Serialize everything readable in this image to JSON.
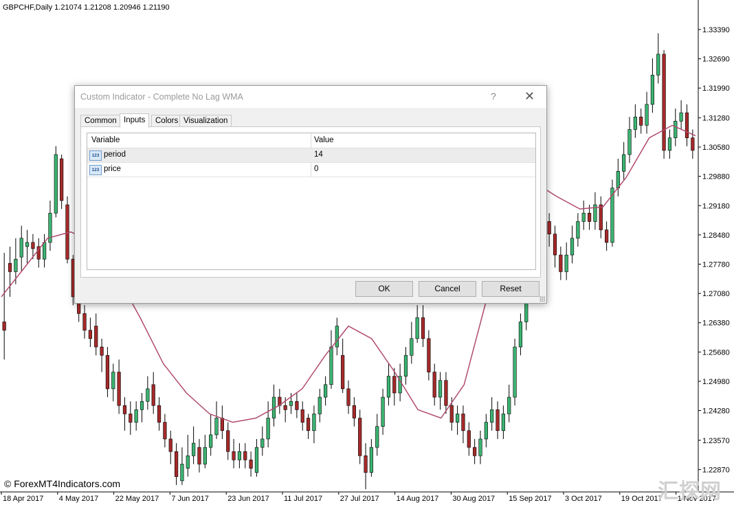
{
  "chart_header": "GBPCHF,Daily  1.21074 1.21208 1.20946 1.21190",
  "price_axis": [
    "1.33390",
    "1.32690",
    "1.31990",
    "1.31280",
    "1.30580",
    "1.29880",
    "1.29180",
    "1.28480",
    "1.27780",
    "1.27080",
    "1.26380",
    "1.25680",
    "1.24980",
    "1.24280",
    "1.23570",
    "1.22870"
  ],
  "date_axis": [
    "18 Apr 2017",
    "4 May 2017",
    "22 May 2017",
    "7 Jun 2017",
    "23 Jun 2017",
    "11 Jul 2017",
    "27 Jul 2017",
    "14 Aug 2017",
    "30 Aug 2017",
    "15 Sep 2017",
    "3 Oct 2017",
    "19 Oct 2017",
    "1 Nov 2017"
  ],
  "watermark": "© ForexMT4Indicators.com",
  "corner_watermark": "汇探网",
  "colors": {
    "bull": "#3cb371",
    "bear": "#a52a2a",
    "wma": "#b04a6e",
    "axis": "#000000"
  },
  "chart_data": {
    "type": "candlestick",
    "symbol": "GBPCHF",
    "timeframe": "Daily",
    "header_ohlc": {
      "open": 1.21074,
      "high": 1.21208,
      "low": 1.20946,
      "close": 1.2119
    },
    "ylim": [
      1.224,
      1.338
    ],
    "indicator": "Complete No Lag WMA (period 14)",
    "wma": [
      1.27,
      1.277,
      1.284,
      1.2855,
      1.283,
      1.275,
      1.265,
      1.254,
      1.247,
      1.242,
      1.24,
      1.241,
      1.244,
      1.248,
      1.256,
      1.263,
      1.26,
      1.252,
      1.243,
      1.241,
      1.249,
      1.27,
      1.292,
      1.2975,
      1.294,
      1.291,
      1.2915,
      1.2985,
      1.308,
      1.311,
      1.3085
    ],
    "candles": [
      [
        1.264,
        1.262,
        1.2805,
        1.255
      ],
      [
        1.278,
        1.276,
        1.282,
        1.27
      ],
      [
        1.276,
        1.279,
        1.284,
        1.273
      ],
      [
        1.2795,
        1.284,
        1.287,
        1.276
      ],
      [
        1.282,
        1.283,
        1.286,
        1.278
      ],
      [
        1.283,
        1.2815,
        1.285,
        1.279
      ],
      [
        1.282,
        1.279,
        1.284,
        1.277
      ],
      [
        1.279,
        1.283,
        1.285,
        1.277
      ],
      [
        1.283,
        1.29,
        1.293,
        1.281
      ],
      [
        1.29,
        1.304,
        1.306,
        1.289
      ],
      [
        1.303,
        1.293,
        1.304,
        1.291
      ],
      [
        1.292,
        1.279,
        1.294,
        1.278
      ],
      [
        1.279,
        1.27,
        1.28,
        1.268
      ],
      [
        1.27,
        1.266,
        1.272,
        1.264
      ],
      [
        1.266,
        1.262,
        1.268,
        1.26
      ],
      [
        1.262,
        1.26,
        1.265,
        1.258
      ],
      [
        1.263,
        1.258,
        1.266,
        1.256
      ],
      [
        1.258,
        1.256,
        1.26,
        1.252
      ],
      [
        1.256,
        1.248,
        1.258,
        1.246
      ],
      [
        1.248,
        1.252,
        1.254,
        1.245
      ],
      [
        1.252,
        1.244,
        1.255,
        1.242
      ],
      [
        1.244,
        1.242,
        1.246,
        1.238
      ],
      [
        1.242,
        1.24,
        1.245,
        1.237
      ],
      [
        1.24,
        1.243,
        1.245,
        1.238
      ],
      [
        1.243,
        1.245,
        1.247,
        1.24
      ],
      [
        1.245,
        1.248,
        1.251,
        1.243
      ],
      [
        1.249,
        1.244,
        1.252,
        1.242
      ],
      [
        1.244,
        1.24,
        1.246,
        1.238
      ],
      [
        1.24,
        1.236,
        1.242,
        1.234
      ],
      [
        1.236,
        1.233,
        1.238,
        1.23
      ],
      [
        1.233,
        1.227,
        1.235,
        1.225
      ],
      [
        1.226,
        1.23,
        1.234,
        1.225
      ],
      [
        1.229,
        1.232,
        1.237,
        1.227
      ],
      [
        1.232,
        1.235,
        1.239,
        1.23
      ],
      [
        1.234,
        1.23,
        1.236,
        1.228
      ],
      [
        1.23,
        1.234,
        1.237,
        1.229
      ],
      [
        1.234,
        1.237,
        1.242,
        1.232
      ],
      [
        1.237,
        1.241,
        1.245,
        1.236
      ],
      [
        1.241,
        1.238,
        1.244,
        1.236
      ],
      [
        1.238,
        1.233,
        1.24,
        1.231
      ],
      [
        1.233,
        1.231,
        1.236,
        1.229
      ],
      [
        1.231,
        1.233,
        1.235,
        1.229
      ],
      [
        1.233,
        1.231,
        1.235,
        1.229
      ],
      [
        1.231,
        1.229,
        1.233,
        1.227
      ],
      [
        1.228,
        1.234,
        1.236,
        1.227
      ],
      [
        1.234,
        1.236,
        1.239,
        1.232
      ],
      [
        1.236,
        1.241,
        1.245,
        1.234
      ],
      [
        1.241,
        1.246,
        1.249,
        1.239
      ],
      [
        1.246,
        1.244,
        1.248,
        1.242
      ],
      [
        1.244,
        1.243,
        1.246,
        1.24
      ],
      [
        1.244,
        1.245,
        1.247,
        1.242
      ],
      [
        1.245,
        1.243,
        1.247,
        1.241
      ],
      [
        1.243,
        1.24,
        1.245,
        1.238
      ],
      [
        1.241,
        1.238,
        1.242,
        1.236
      ],
      [
        1.238,
        1.242,
        1.244,
        1.235
      ],
      [
        1.242,
        1.246,
        1.248,
        1.24
      ],
      [
        1.246,
        1.249,
        1.251,
        1.244
      ],
      [
        1.249,
        1.258,
        1.262,
        1.248
      ],
      [
        1.258,
        1.263,
        1.265,
        1.256
      ],
      [
        1.256,
        1.248,
        1.26,
        1.247
      ],
      [
        1.248,
        1.244,
        1.25,
        1.242
      ],
      [
        1.244,
        1.241,
        1.246,
        1.239
      ],
      [
        1.241,
        1.232,
        1.243,
        1.23
      ],
      [
        1.232,
        1.228,
        1.235,
        1.224
      ],
      [
        1.228,
        1.234,
        1.236,
        1.227
      ],
      [
        1.234,
        1.239,
        1.242,
        1.232
      ],
      [
        1.239,
        1.246,
        1.248,
        1.237
      ],
      [
        1.246,
        1.251,
        1.254,
        1.244
      ],
      [
        1.251,
        1.247,
        1.253,
        1.244
      ],
      [
        1.247,
        1.251,
        1.254,
        1.245
      ],
      [
        1.251,
        1.256,
        1.258,
        1.249
      ],
      [
        1.256,
        1.26,
        1.264,
        1.254
      ],
      [
        1.26,
        1.265,
        1.268,
        1.259
      ],
      [
        1.265,
        1.26,
        1.268,
        1.258
      ],
      [
        1.26,
        1.252,
        1.262,
        1.25
      ],
      [
        1.252,
        1.246,
        1.254,
        1.244
      ],
      [
        1.246,
        1.25,
        1.252,
        1.243
      ],
      [
        1.25,
        1.244,
        1.252,
        1.242
      ],
      [
        1.244,
        1.24,
        1.246,
        1.238
      ],
      [
        1.24,
        1.242,
        1.244,
        1.237
      ],
      [
        1.242,
        1.238,
        1.244,
        1.235
      ],
      [
        1.238,
        1.234,
        1.24,
        1.232
      ],
      [
        1.234,
        1.232,
        1.236,
        1.23
      ],
      [
        1.232,
        1.236,
        1.238,
        1.23
      ],
      [
        1.236,
        1.24,
        1.242,
        1.234
      ],
      [
        1.24,
        1.243,
        1.246,
        1.238
      ],
      [
        1.243,
        1.238,
        1.245,
        1.236
      ],
      [
        1.238,
        1.242,
        1.244,
        1.236
      ],
      [
        1.242,
        1.246,
        1.249,
        1.24
      ],
      [
        1.246,
        1.258,
        1.26,
        1.244
      ],
      [
        1.258,
        1.264,
        1.266,
        1.256
      ],
      [
        1.264,
        1.27,
        1.272,
        1.262
      ],
      [
        1.312,
        1.3,
        1.315,
        1.298
      ],
      [
        1.3,
        1.293,
        1.302,
        1.29
      ],
      [
        1.293,
        1.288,
        1.295,
        1.286
      ],
      [
        1.288,
        1.285,
        1.29,
        1.282
      ],
      [
        1.285,
        1.28,
        1.287,
        1.277
      ],
      [
        1.28,
        1.276,
        1.282,
        1.274
      ],
      [
        1.276,
        1.28,
        1.283,
        1.274
      ],
      [
        1.28,
        1.284,
        1.287,
        1.278
      ],
      [
        1.284,
        1.288,
        1.29,
        1.282
      ],
      [
        1.288,
        1.29,
        1.293,
        1.286
      ],
      [
        1.29,
        1.288,
        1.292,
        1.286
      ],
      [
        1.288,
        1.292,
        1.295,
        1.286
      ],
      [
        1.292,
        1.286,
        1.294,
        1.284
      ],
      [
        1.286,
        1.283,
        1.288,
        1.281
      ],
      [
        1.283,
        1.296,
        1.298,
        1.282
      ],
      [
        1.296,
        1.3,
        1.303,
        1.294
      ],
      [
        1.3,
        1.304,
        1.307,
        1.298
      ],
      [
        1.304,
        1.31,
        1.313,
        1.302
      ],
      [
        1.31,
        1.313,
        1.316,
        1.308
      ],
      [
        1.313,
        1.311,
        1.315,
        1.309
      ],
      [
        1.311,
        1.316,
        1.319,
        1.309
      ],
      [
        1.316,
        1.323,
        1.327,
        1.314
      ],
      [
        1.323,
        1.328,
        1.333,
        1.321
      ],
      [
        1.328,
        1.305,
        1.329,
        1.303
      ],
      [
        1.305,
        1.308,
        1.31,
        1.303
      ],
      [
        1.308,
        1.312,
        1.315,
        1.306
      ],
      [
        1.312,
        1.314,
        1.317,
        1.31
      ],
      [
        1.314,
        1.308,
        1.316,
        1.306
      ],
      [
        1.308,
        1.305,
        1.31,
        1.303
      ]
    ]
  },
  "dialog": {
    "title": "Custom Indicator - Complete No Lag WMA",
    "help": "?",
    "close": "✕",
    "tabs": [
      "Common",
      "Inputs",
      "Colors",
      "Visualization"
    ],
    "active_tab": "Inputs",
    "table": {
      "headers": [
        "Variable",
        "Value"
      ],
      "rows": [
        {
          "icon": "123",
          "variable": "period",
          "value": "14"
        },
        {
          "icon": "123",
          "variable": "price",
          "value": "0"
        }
      ]
    },
    "buttons": {
      "ok": "OK",
      "cancel": "Cancel",
      "reset": "Reset"
    }
  }
}
